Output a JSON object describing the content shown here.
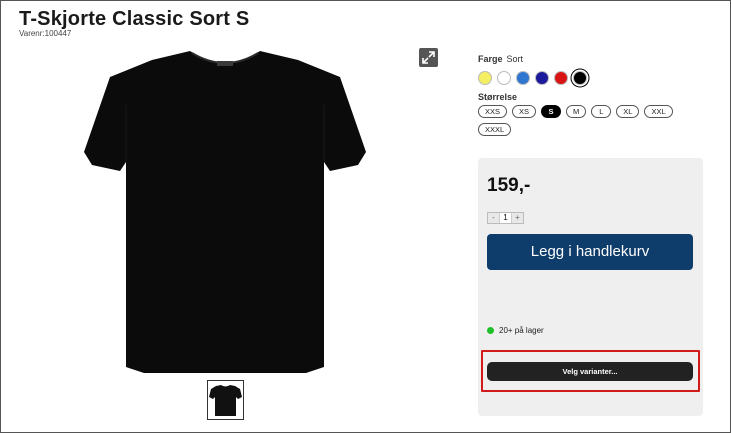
{
  "product": {
    "title": "T-Skjorte Classic Sort S",
    "sku": "Varenr:100447"
  },
  "colors": {
    "label": "Farge",
    "selected_name": "Sort",
    "swatches": [
      "#f4ee62",
      "#ffffff",
      "#2f76d0",
      "#1a1a9a",
      "#d81414",
      "#000000"
    ],
    "selected_index": 5
  },
  "sizes": {
    "label": "Størrelse",
    "options": [
      "XXS",
      "XS",
      "S",
      "M",
      "L",
      "XL",
      "XXL",
      "XXXL"
    ],
    "selected": "S"
  },
  "buy_box": {
    "price": "159,-",
    "quantity": "1",
    "minus": "-",
    "plus": "+",
    "add_to_cart": "Legg i handlekurv",
    "stock_status": "20+ på lager",
    "choose_variants": "Velg varianter..."
  },
  "icons": {
    "expand": "expand-icon",
    "stock": "stock-dot-icon"
  },
  "accent_colors": {
    "cart_button": "#0e3c6b",
    "in_stock": "#1fbf2a",
    "highlight": "#d11a1a"
  }
}
